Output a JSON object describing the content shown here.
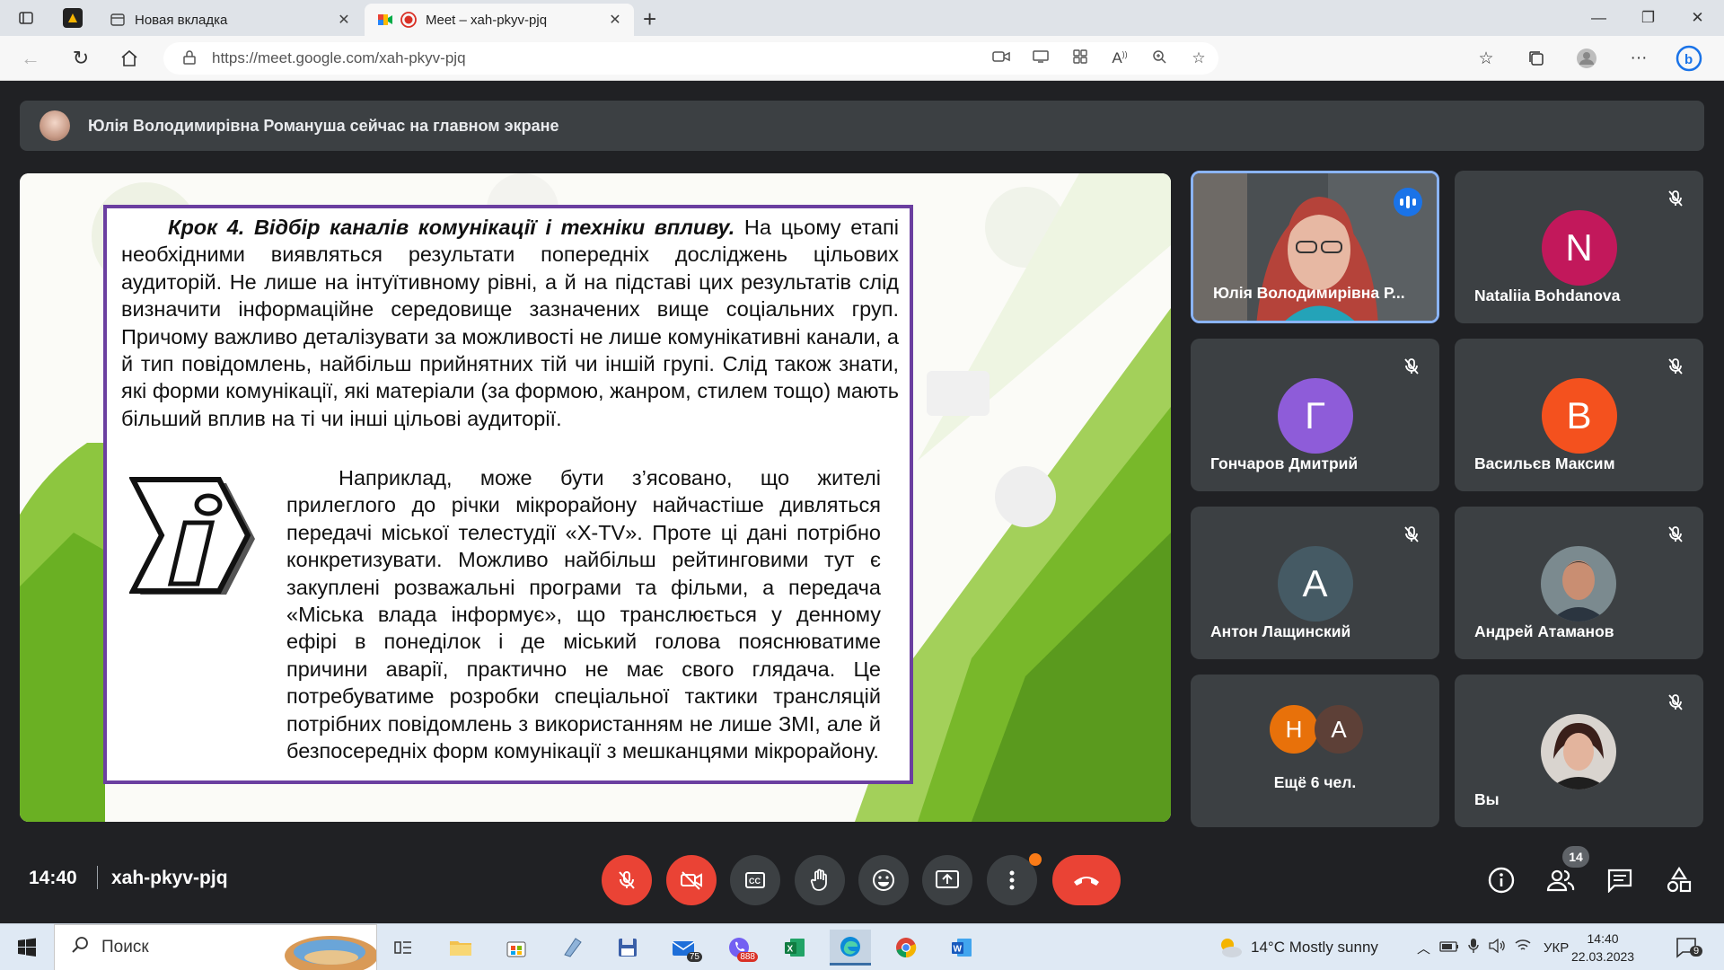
{
  "browser": {
    "tabs": [
      {
        "title": "Новая вкладка"
      },
      {
        "title": "Meet – xah-pkyv-pjq"
      }
    ],
    "url": "https://meet.google.com/xah-pkyv-pjq"
  },
  "meet": {
    "banner_text": "Юлія Володимирівна Романуша сейчас на главном экране",
    "slide": {
      "heading": "Крок 4. Відбір каналів комунікації і техніки впливу.",
      "paragraph1": "На цьому етапі необхідними виявляться результати попередніх досліджень цільових аудиторій. Не лише на інтуїтивному рівні, а й на підставі цих результатів слід визначити інформаційне середовище зазначених вище соціальних груп. Причому важливо деталізувати за можливості не лише комунікативні канали, а й тип повідомлень, найбільш прийнятних тій чи іншій групі. Слід також знати, які форми комунікації, які матеріали (за формою, жанром, стилем тощо) мають більший вплив на ті чи інші цільові аудиторії.",
      "paragraph2": "Наприклад, може бути з’ясовано, що жителі прилеглого до річки мікрорайону найчастіше дивляться передачі міської телестудії «X-TV». Проте ці дані потрібно конкретизувати. Можливо найбільш рейтинговими тут є закуплені розважальні програми та фільми, а передача «Міська влада інформує», що транслюється у денному ефірі в понеділок і де міський голова пояснюватиме причини аварії, практично не має свого глядача. Це потребуватиме розробки спеціальної тактики трансляцій потрібних повідомлень з використанням не лише ЗМІ, але й безпосередніх форм комунікації з мешканцями мікрорайону."
    },
    "participants": [
      {
        "name": "Юлія Володимирівна Р...",
        "letter": "",
        "color": "",
        "speaking": true
      },
      {
        "name": "Nataliia Bohdanova",
        "letter": "N",
        "color": "#c2185b"
      },
      {
        "name": "Гончаров Дмитрий",
        "letter": "Г",
        "color": "#8e5cd9"
      },
      {
        "name": "Васильєв Максим",
        "letter": "В",
        "color": "#f4511e"
      },
      {
        "name": "Антон Лащинский",
        "letter": "А",
        "color": "#455a64"
      },
      {
        "name": "Андрей Атаманов",
        "letter": "",
        "color": ""
      },
      {
        "name": "Ещё 6 чел.",
        "letters": [
          "Н",
          "А"
        ],
        "colors": [
          "#e8710a",
          "#5d4037"
        ]
      },
      {
        "name": "Вы",
        "letter": "",
        "color": ""
      }
    ],
    "time": "14:40",
    "meeting_code": "xah-pkyv-pjq",
    "people_count": "14"
  },
  "taskbar": {
    "search_placeholder": "Поиск",
    "weather": "14°C  Mostly sunny",
    "lang": "УКР",
    "clock_time": "14:40",
    "clock_date": "22.03.2023",
    "mail_badge": "75",
    "viber_badge": "888",
    "notif_count": "9"
  }
}
